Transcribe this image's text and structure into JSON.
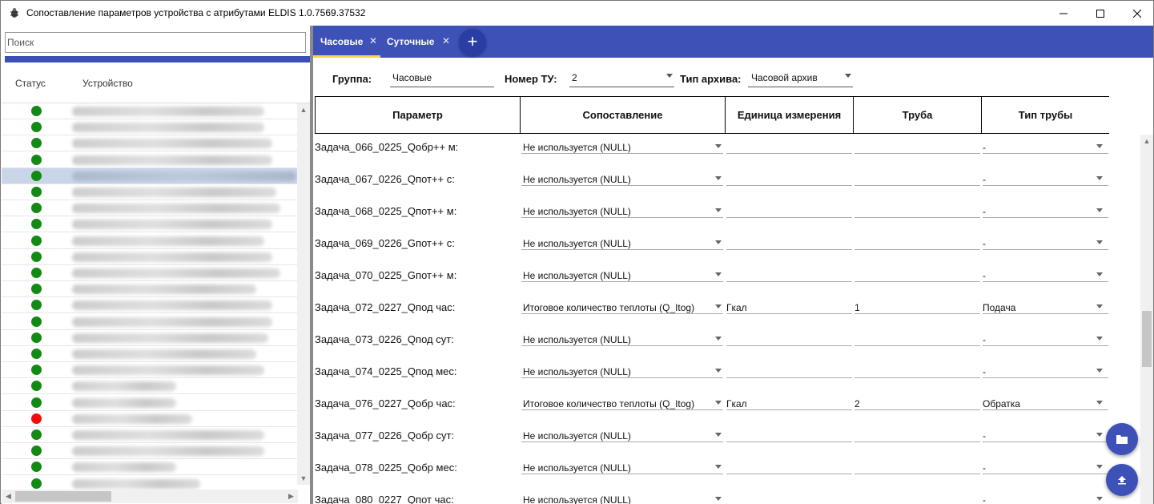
{
  "window": {
    "title": "Сопоставление параметров устройства с атрибутами ELDIS 1.0.7569.37532",
    "icons": [
      "app-icon",
      "minimize-icon",
      "maximize-icon",
      "close-icon"
    ]
  },
  "left": {
    "search_placeholder": "Поиск",
    "col_status": "Статус",
    "col_device": "Устройство",
    "devices": [
      {
        "status": "green",
        "selected": false
      },
      {
        "status": "green",
        "selected": false
      },
      {
        "status": "green",
        "selected": false
      },
      {
        "status": "green",
        "selected": false
      },
      {
        "status": "green",
        "selected": true
      },
      {
        "status": "green",
        "selected": false
      },
      {
        "status": "green",
        "selected": false
      },
      {
        "status": "green",
        "selected": false
      },
      {
        "status": "green",
        "selected": false
      },
      {
        "status": "green",
        "selected": false
      },
      {
        "status": "green",
        "selected": false
      },
      {
        "status": "green",
        "selected": false
      },
      {
        "status": "green",
        "selected": false
      },
      {
        "status": "green",
        "selected": false
      },
      {
        "status": "green",
        "selected": false
      },
      {
        "status": "green",
        "selected": false
      },
      {
        "status": "green",
        "selected": false
      },
      {
        "status": "green",
        "selected": false
      },
      {
        "status": "green",
        "selected": false
      },
      {
        "status": "red",
        "selected": false
      },
      {
        "status": "green",
        "selected": false
      },
      {
        "status": "green",
        "selected": false
      },
      {
        "status": "green",
        "selected": false
      },
      {
        "status": "green",
        "selected": false
      }
    ],
    "colors": {
      "green": "#138a13",
      "red": "#f20d0d",
      "selected": "#c9d6ea"
    }
  },
  "tabs": [
    {
      "label": "Часовые",
      "active": true
    },
    {
      "label": "Суточные",
      "active": false
    }
  ],
  "tabbar_color": "#3d51b7",
  "filters": {
    "group_label": "Группа:",
    "group_value": "Часовые",
    "tu_label": "Номер ТУ:",
    "tu_value": "2",
    "archive_label": "Тип архива:",
    "archive_value": "Часовой архив"
  },
  "table": {
    "headers": [
      "Параметр",
      "Сопоставление",
      "Единица измерения",
      "Труба",
      "Тип трубы"
    ],
    "rows": [
      {
        "param": "Задача_066_0225_Qобр++ м:",
        "mapping": "Не используется (NULL)",
        "unit": "",
        "pipe": "",
        "pipe_type": "-"
      },
      {
        "param": "Задача_067_0226_Qпот++ с:",
        "mapping": "Не используется (NULL)",
        "unit": "",
        "pipe": "",
        "pipe_type": "-"
      },
      {
        "param": "Задача_068_0225_Qпот++ м:",
        "mapping": "Не используется (NULL)",
        "unit": "",
        "pipe": "",
        "pipe_type": "-"
      },
      {
        "param": "Задача_069_0226_Gпот++ с:",
        "mapping": "Не используется (NULL)",
        "unit": "",
        "pipe": "",
        "pipe_type": "-"
      },
      {
        "param": "Задача_070_0225_Gпот++ м:",
        "mapping": "Не используется (NULL)",
        "unit": "",
        "pipe": "",
        "pipe_type": "-"
      },
      {
        "param": "Задача_072_0227_Qпод час:",
        "mapping": "Итоговое количество теплоты (Q_Itog)",
        "unit": "Гкал",
        "pipe": "1",
        "pipe_type": "Подача"
      },
      {
        "param": "Задача_073_0226_Qпод сут:",
        "mapping": "Не используется (NULL)",
        "unit": "",
        "pipe": "",
        "pipe_type": "-"
      },
      {
        "param": "Задача_074_0225_Qпод мес:",
        "mapping": "Не используется (NULL)",
        "unit": "",
        "pipe": "",
        "pipe_type": "-"
      },
      {
        "param": "Задача_076_0227_Qобр час:",
        "mapping": "Итоговое количество теплоты (Q_Itog)",
        "unit": "Гкал",
        "pipe": "2",
        "pipe_type": "Обратка"
      },
      {
        "param": "Задача_077_0226_Qобр сут:",
        "mapping": "Не используется (NULL)",
        "unit": "",
        "pipe": "",
        "pipe_type": "-"
      },
      {
        "param": "Задача_078_0225_Qобр мес:",
        "mapping": "Не используется (NULL)",
        "unit": "",
        "pipe": "",
        "pipe_type": "-"
      },
      {
        "param": "Задача_080_0227_Qпот час:",
        "mapping": "Не используется (NULL)",
        "unit": "",
        "pipe": "",
        "pipe_type": "-"
      }
    ]
  },
  "fabs": [
    "folder-icon",
    "upload-icon"
  ]
}
